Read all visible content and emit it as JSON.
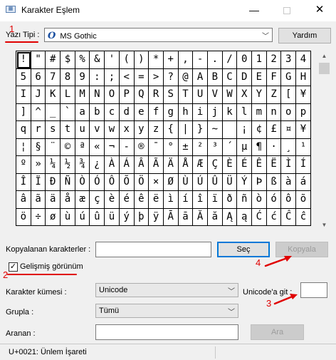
{
  "window": {
    "title": "Karakter Eşlem",
    "minimize_glyph": "—",
    "close_glyph": "✕"
  },
  "font": {
    "label": "Yazı Tipi :",
    "selected": "MS Gothic",
    "help_button": "Yardım"
  },
  "grid": {
    "selected_index": 0,
    "rows": [
      [
        "!",
        "\"",
        "#",
        "$",
        "%",
        "&",
        "'",
        "(",
        ")",
        "*",
        "+",
        ",",
        "-",
        ".",
        "/",
        "0",
        "1",
        "2",
        "3",
        "4"
      ],
      [
        "5",
        "6",
        "7",
        "8",
        "9",
        ":",
        ";",
        "<",
        "=",
        ">",
        "?",
        "@",
        "A",
        "B",
        "C",
        "D",
        "E",
        "F",
        "G",
        "H"
      ],
      [
        "I",
        "J",
        "K",
        "L",
        "M",
        "N",
        "O",
        "P",
        "Q",
        "R",
        "S",
        "T",
        "U",
        "V",
        "W",
        "X",
        "Y",
        "Z",
        "[",
        "¥"
      ],
      [
        "]",
        "^",
        "_",
        "`",
        "a",
        "b",
        "c",
        "d",
        "e",
        "f",
        "g",
        "h",
        "i",
        "j",
        "k",
        "l",
        "m",
        "n",
        "o",
        "p"
      ],
      [
        "q",
        "r",
        "s",
        "t",
        "u",
        "v",
        "w",
        "x",
        "y",
        "z",
        "{",
        "|",
        "}",
        "~",
        " ",
        "¡",
        "¢",
        "£",
        "¤",
        "¥"
      ],
      [
        "¦",
        "§",
        "¨",
        "©",
        "ª",
        "«",
        "¬",
        "-",
        "®",
        "¯",
        "°",
        "±",
        "²",
        "³",
        "´",
        "µ",
        "¶",
        "·",
        "¸",
        "¹"
      ],
      [
        "º",
        "»",
        "¼",
        "½",
        "¾",
        "¿",
        "À",
        "Á",
        "Â",
        "Ã",
        "Ä",
        "Å",
        "Æ",
        "Ç",
        "È",
        "É",
        "Ê",
        "Ë",
        "Ì",
        "Í"
      ],
      [
        "Î",
        "Ï",
        "Ð",
        "Ñ",
        "Ò",
        "Ó",
        "Ô",
        "Õ",
        "Ö",
        "×",
        "Ø",
        "Ù",
        "Ú",
        "Û",
        "Ü",
        "Ý",
        "Þ",
        "ß",
        "à",
        "á"
      ],
      [
        "â",
        "ã",
        "ä",
        "å",
        "æ",
        "ç",
        "è",
        "é",
        "ê",
        "ë",
        "ì",
        "í",
        "î",
        "ï",
        "ð",
        "ñ",
        "ò",
        "ó",
        "ô",
        "õ"
      ],
      [
        "ö",
        "÷",
        "ø",
        "ù",
        "ú",
        "û",
        "ü",
        "ý",
        "þ",
        "ÿ",
        "Ā",
        "ā",
        "Ă",
        "ă",
        "Ą",
        "ą",
        "Ć",
        "ć",
        "Ĉ",
        "ĉ"
      ]
    ]
  },
  "copy": {
    "label": "Kopyalanan karakterler :",
    "value": "",
    "select_button": "Seç",
    "copy_button": "Kopyala"
  },
  "advanced": {
    "label": "Gelişmiş görünüm",
    "checked": true
  },
  "charset": {
    "label": "Karakter kümesi :",
    "selected": "Unicode"
  },
  "goto_unicode": {
    "label": "Unicode'a git :",
    "value": ""
  },
  "group": {
    "label": "Grupla :",
    "selected": "Tümü"
  },
  "search": {
    "label": "Aranan :",
    "value": "",
    "button": "Ara"
  },
  "status": {
    "text": "U+0021: Ünlem İşareti"
  },
  "annotations": {
    "n1": "1",
    "n2": "2",
    "n3": "3",
    "n4": "4",
    "color": "#e00000"
  }
}
